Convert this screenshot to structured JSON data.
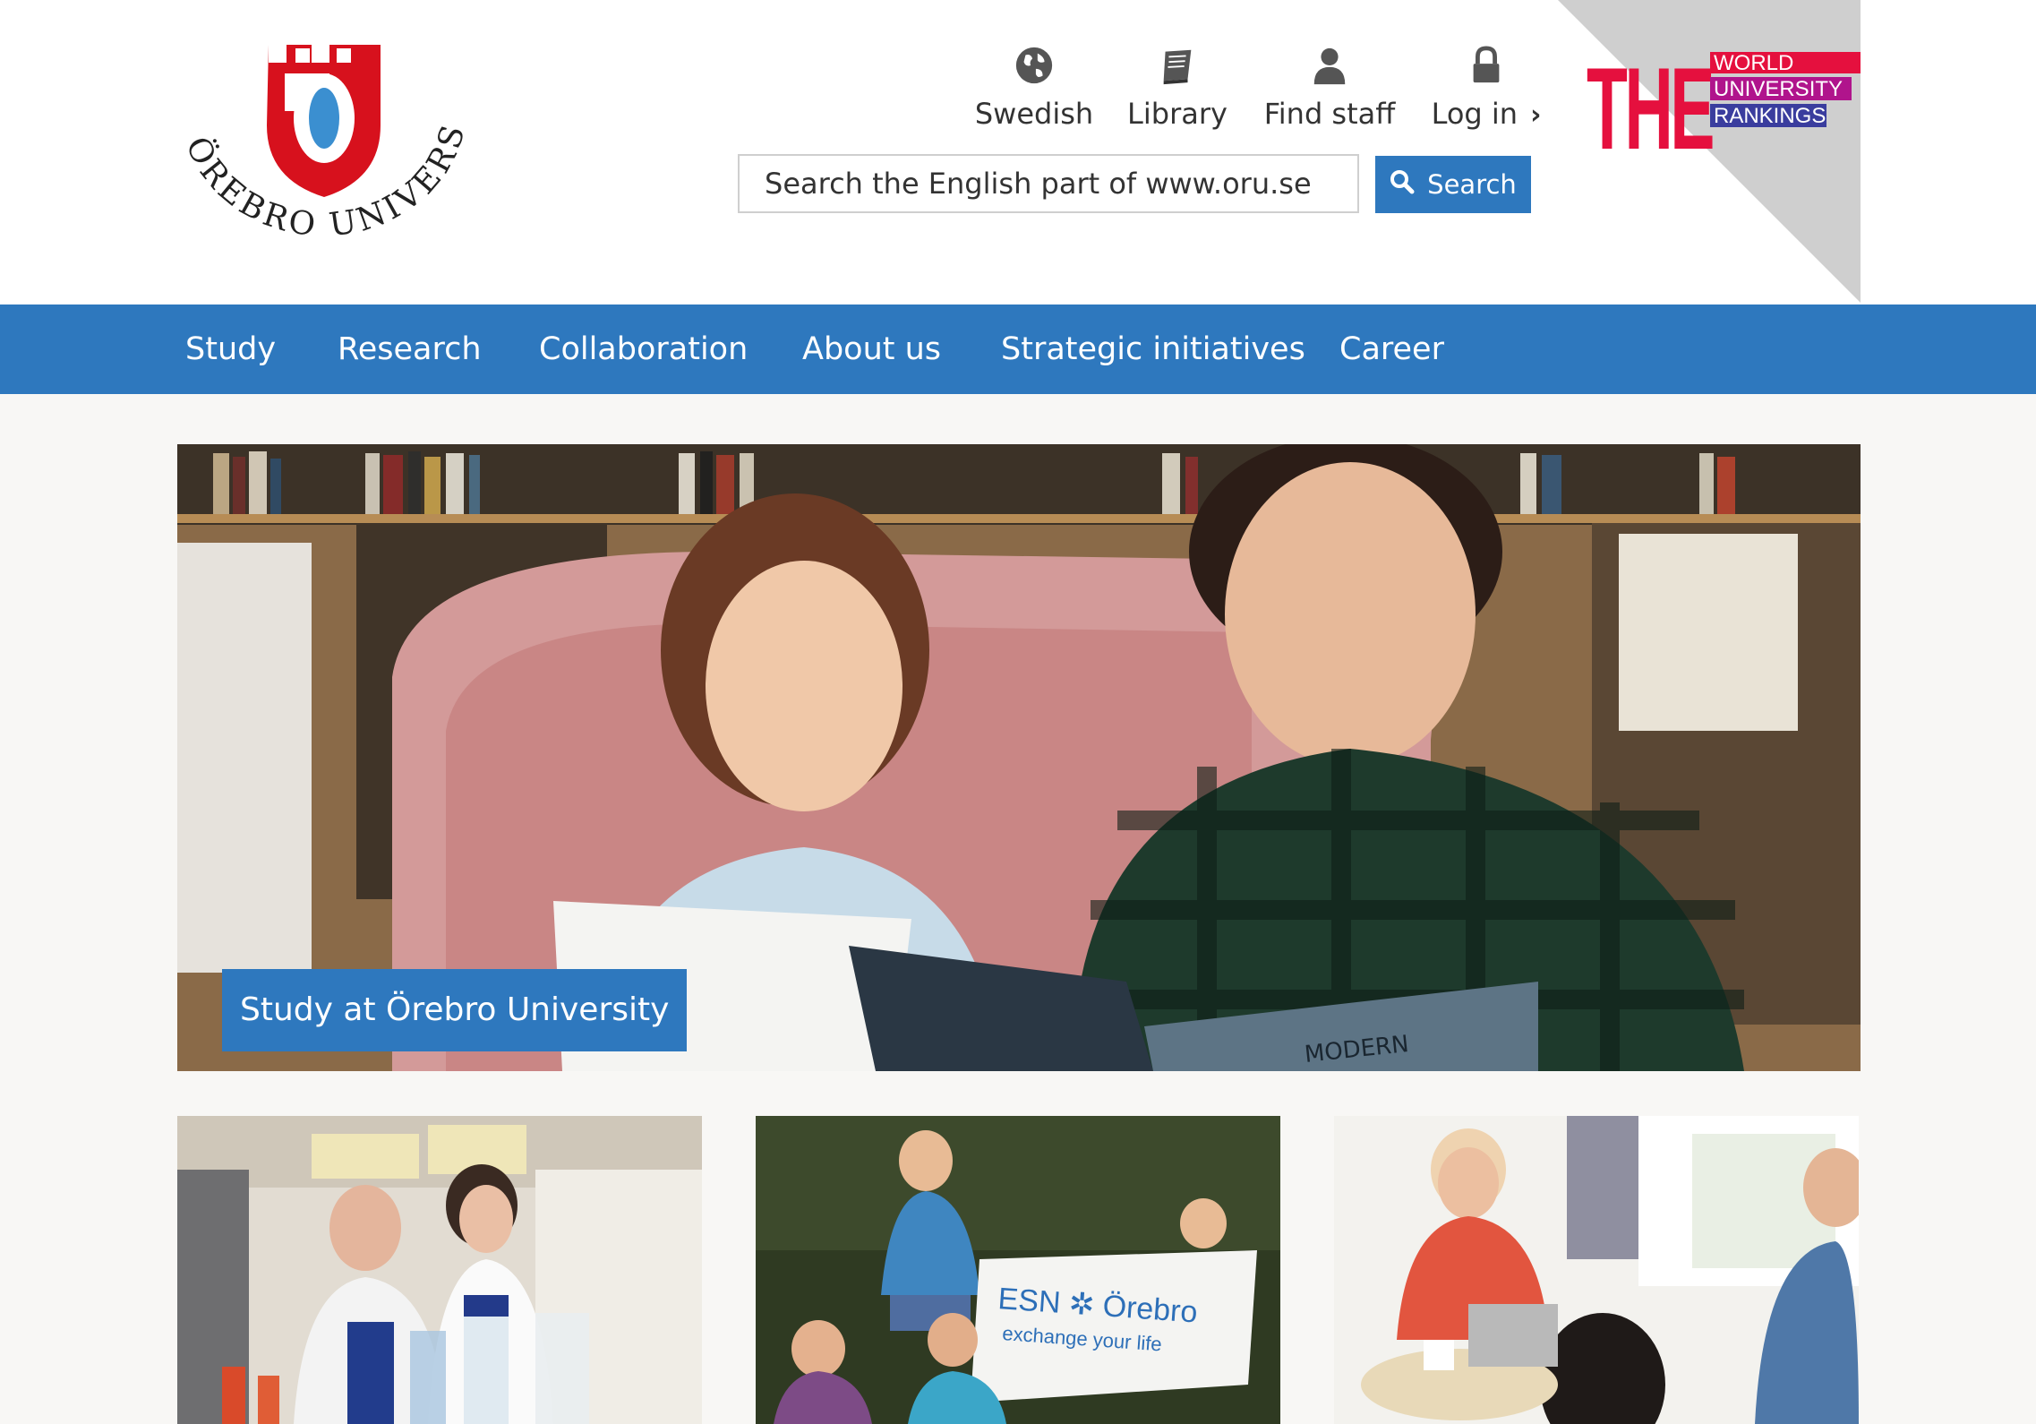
{
  "logo": {
    "wordmark": "ÖREBRO UNIVERSITY",
    "shield_letter": "Ö",
    "colors": {
      "shield": "#d7111d",
      "inner": "#3b8fd0"
    }
  },
  "quick_links": [
    {
      "label": "Swedish",
      "icon": "globe-icon"
    },
    {
      "label": "Library",
      "icon": "book-icon"
    },
    {
      "label": "Find staff",
      "icon": "person-icon"
    },
    {
      "label": "Log in",
      "icon": "lock-icon",
      "chevron": "chevron-right-icon"
    }
  ],
  "search": {
    "placeholder": "Search the English part of www.oru.se",
    "button_label": "Search"
  },
  "the_badge": {
    "big": "THE",
    "lines": [
      "WORLD",
      "UNIVERSITY",
      "RANKINGS"
    ],
    "colors": {
      "the": "#e5103e",
      "the_blue": "#2a3c8e",
      "band": "#e5103e",
      "band2": "#b0148c",
      "band3": "#3a3d9e"
    }
  },
  "nav": {
    "items": [
      "Study",
      "Research",
      "Collaboration",
      "About us",
      "Strategic initiatives",
      "Career"
    ]
  },
  "hero": {
    "caption": "Study at Örebro University",
    "book_text": "MODERN"
  },
  "cards": [
    {
      "alt_icon": "lab-photo"
    },
    {
      "alt_icon": "esn-photo",
      "banner_title": "ESN ✲ Örebro",
      "banner_sub": "exchange your life"
    },
    {
      "alt_icon": "meeting-photo"
    }
  ],
  "colors": {
    "brand_blue": "#2e78be",
    "page_bg": "#f8f7f5"
  }
}
